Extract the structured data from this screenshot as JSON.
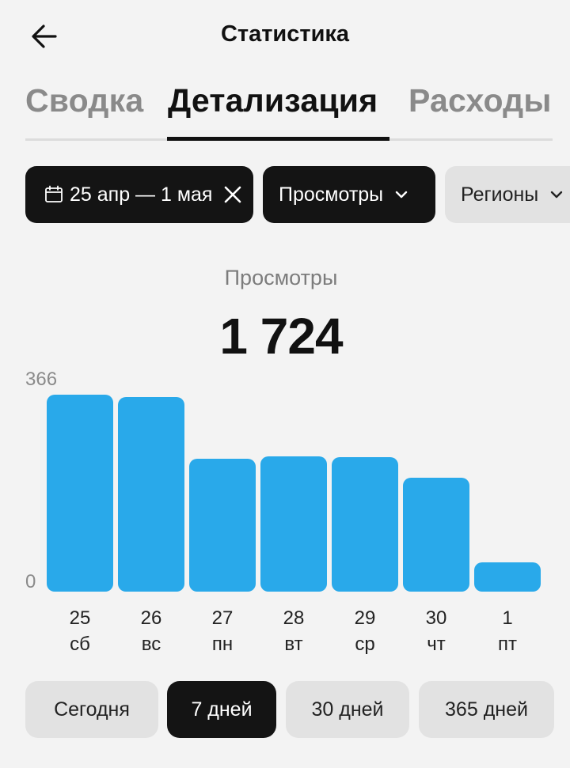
{
  "header": {
    "title": "Статистика"
  },
  "tabs": [
    {
      "label": "Сводка",
      "active": false
    },
    {
      "label": "Детализация",
      "active": true
    },
    {
      "label": "Расходы",
      "active": false
    }
  ],
  "filters": {
    "date_range": "25 апр — 1 мая",
    "metric": "Просмотры",
    "region": "Регионы"
  },
  "summary": {
    "label": "Просмотры",
    "value": "1 724"
  },
  "chart_data": {
    "type": "bar",
    "categories": [
      "25",
      "26",
      "27",
      "28",
      "29",
      "30",
      "1"
    ],
    "weekdays": [
      "сб",
      "вс",
      "пн",
      "вт",
      "ср",
      "чт",
      "пт"
    ],
    "values": [
      340,
      336,
      230,
      234,
      232,
      196,
      50
    ],
    "ylim": [
      0,
      366
    ],
    "y_tick_labels": [
      "366",
      "0"
    ],
    "color": "#29a9ea"
  },
  "periods": [
    {
      "label": "Сегодня",
      "active": false
    },
    {
      "label": "7 дней",
      "active": true
    },
    {
      "label": "30 дней",
      "active": false
    },
    {
      "label": "365 дней",
      "active": false
    }
  ],
  "colors": {
    "accent": "#29a9ea",
    "dark": "#141414",
    "chip_light": "#e2e2e2",
    "background": "#f3f3f3"
  }
}
